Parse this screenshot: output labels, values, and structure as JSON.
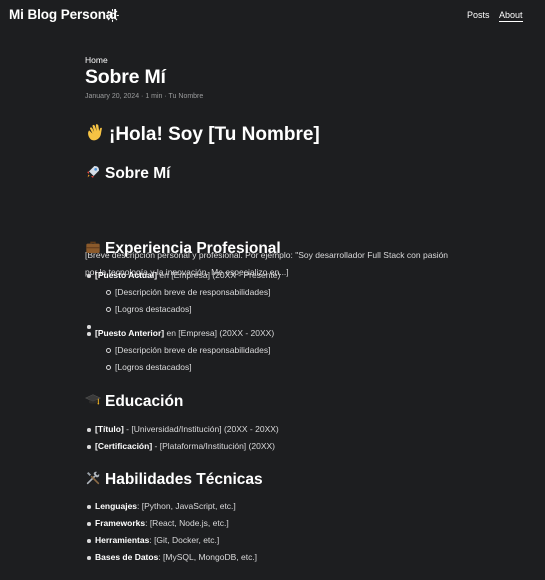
{
  "header": {
    "site_title": "Mi Blog Personal",
    "nav": [
      {
        "label": "Posts"
      },
      {
        "label": "About"
      }
    ]
  },
  "page": {
    "breadcrumb": "Home",
    "title": "Sobre Mí",
    "meta": "January 20, 2024 · 1 min · Tu Nombre"
  },
  "content": {
    "greeting": "¡Hola! Soy [Tu Nombre]",
    "about_heading": "Sobre Mí",
    "about_text": "[Breve descripción personal y profesional. Por ejemplo: \"Soy desarrollador Full Stack con pasión por la tecnología y la innovación. Me especializo en...]",
    "experience_heading": "Experiencia Profesional",
    "experience": [
      {
        "role": "[Puesto Actual]",
        "detail": " en [Empresa] (20XX - Presente)",
        "items": [
          "[Descripción breve de responsabilidades]",
          "[Logros destacados]"
        ]
      },
      {
        "role": "[Puesto Anterior]",
        "detail": " en [Empresa] (20XX - 20XX)",
        "items": [
          "[Descripción breve de responsabilidades]",
          "[Logros destacados]"
        ]
      }
    ],
    "education_heading": "Educación",
    "education": [
      {
        "label": "[Título]",
        "detail": " - [Universidad/Institución] (20XX - 20XX)"
      },
      {
        "label": "[Certificación]",
        "detail": " - [Plataforma/Institución] (20XX)"
      }
    ],
    "skills_heading": "Habilidades Técnicas",
    "skills": [
      {
        "label": "Lenguajes",
        "detail": ": [Python, JavaScript, etc.]"
      },
      {
        "label": "Frameworks",
        "detail": ": [React, Node.js, etc.]"
      },
      {
        "label": "Herramientas",
        "detail": ": [Git, Docker, etc.]"
      },
      {
        "label": "Bases de Datos",
        "detail": ": [MySQL, MongoDB, etc.]"
      }
    ]
  },
  "icons": {
    "theme_toggle": "sun-icon",
    "greeting": "waving-hand-icon",
    "about": "rocket-icon",
    "experience": "briefcase-icon",
    "education": "graduation-cap-icon",
    "skills": "tools-icon"
  },
  "colors": {
    "background": "#1d1e20",
    "text": "#dadadb",
    "heading": "#ffffff",
    "muted": "#9b9c9d"
  }
}
